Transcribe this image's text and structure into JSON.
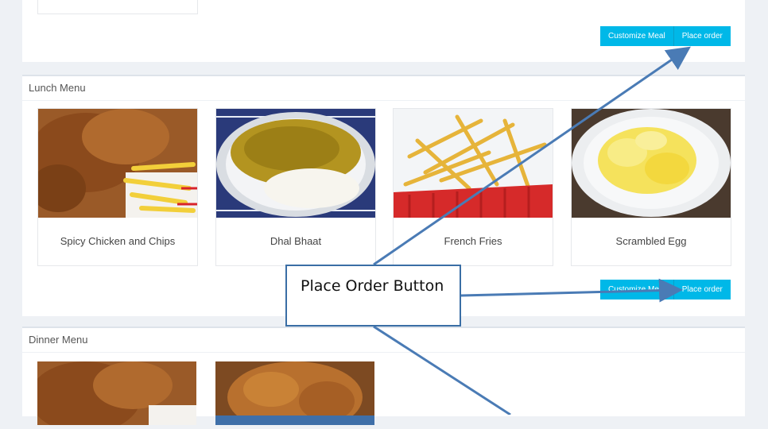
{
  "top_panel": {
    "buttons": {
      "customize": "Customize Meal",
      "place_order": "Place order"
    }
  },
  "lunch": {
    "heading": "Lunch Menu",
    "items": [
      {
        "name": "Spicy Chicken and Chips"
      },
      {
        "name": "Dhal Bhaat"
      },
      {
        "name": "French Fries"
      },
      {
        "name": "Scrambled Egg"
      }
    ],
    "buttons": {
      "customize": "Customize Meal",
      "place_order": "Place order"
    }
  },
  "dinner": {
    "heading": "Dinner Menu"
  },
  "annotation": {
    "label": "Place Order Button"
  },
  "colors": {
    "accent": "#00b8e8",
    "annotation_border": "#3a6ea5",
    "background": "#eef1f5"
  }
}
